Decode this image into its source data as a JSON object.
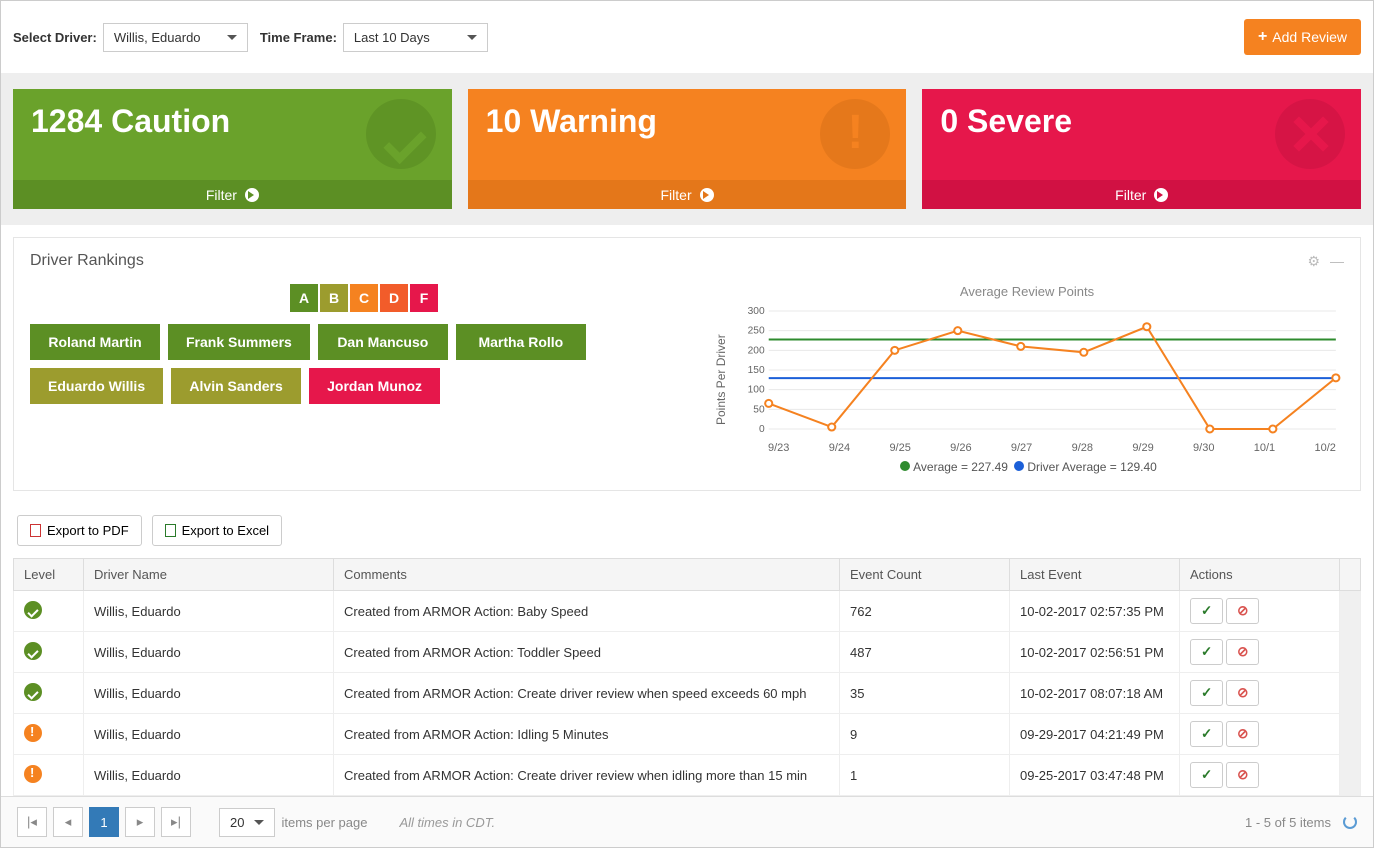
{
  "topbar": {
    "select_driver_label": "Select Driver:",
    "driver_value": "Willis, Eduardo",
    "time_frame_label": "Time Frame:",
    "time_frame_value": "Last 10 Days",
    "add_review_label": "Add Review"
  },
  "cards": {
    "caution": {
      "count": "1284",
      "label": "Caution",
      "filter": "Filter"
    },
    "warning": {
      "count": "10",
      "label": "Warning",
      "filter": "Filter"
    },
    "severe": {
      "count": "0",
      "label": "Severe",
      "filter": "Filter"
    }
  },
  "rankings": {
    "title": "Driver Rankings",
    "grades": [
      "A",
      "B",
      "C",
      "D",
      "F"
    ],
    "drivers": [
      {
        "name": "Roland Martin",
        "grade": "A"
      },
      {
        "name": "Frank Summers",
        "grade": "A"
      },
      {
        "name": "Dan Mancuso",
        "grade": "A"
      },
      {
        "name": "Martha Rollo",
        "grade": "A"
      },
      {
        "name": "Eduardo Willis",
        "grade": "B"
      },
      {
        "name": "Alvin Sanders",
        "grade": "B"
      },
      {
        "name": "Jordan Munoz",
        "grade": "F"
      }
    ]
  },
  "chart_data": {
    "type": "line",
    "title": "Average Review Points",
    "ylabel": "Points Per Driver",
    "ylim": [
      0,
      300
    ],
    "yticks": [
      0,
      50,
      100,
      150,
      200,
      250,
      300
    ],
    "categories": [
      "9/23",
      "9/24",
      "9/25",
      "9/26",
      "9/27",
      "9/28",
      "9/29",
      "9/30",
      "10/1",
      "10/2"
    ],
    "series": [
      {
        "name": "Points",
        "values": [
          65,
          5,
          200,
          250,
          210,
          195,
          260,
          0,
          0,
          130
        ],
        "color": "#f58220"
      }
    ],
    "reference_lines": [
      {
        "label": "Average = 227.49",
        "value": 227.49,
        "color": "#2e8b2e"
      },
      {
        "label": "Driver Average = 129.40",
        "value": 129.4,
        "color": "#1b5fd8"
      }
    ]
  },
  "export": {
    "pdf": "Export to PDF",
    "excel": "Export to Excel"
  },
  "table": {
    "headers": {
      "level": "Level",
      "driver": "Driver Name",
      "comments": "Comments",
      "count": "Event Count",
      "last": "Last Event",
      "actions": "Actions"
    },
    "rows": [
      {
        "level": "green",
        "driver": "Willis, Eduardo",
        "comments": "Created from ARMOR Action: Baby Speed",
        "count": "762",
        "last": "10-02-2017 02:57:35 PM"
      },
      {
        "level": "green",
        "driver": "Willis, Eduardo",
        "comments": "Created from ARMOR Action: Toddler Speed",
        "count": "487",
        "last": "10-02-2017 02:56:51 PM"
      },
      {
        "level": "green",
        "driver": "Willis, Eduardo",
        "comments": "Created from ARMOR Action: Create driver review when speed exceeds 60 mph",
        "count": "35",
        "last": "10-02-2017 08:07:18 AM"
      },
      {
        "level": "orange",
        "driver": "Willis, Eduardo",
        "comments": "Created from ARMOR Action: Idling 5 Minutes",
        "count": "9",
        "last": "09-29-2017 04:21:49 PM"
      },
      {
        "level": "orange",
        "driver": "Willis, Eduardo",
        "comments": "Created from ARMOR Action: Create driver review when idling more than 15 min",
        "count": "1",
        "last": "09-25-2017 03:47:48 PM"
      }
    ]
  },
  "pager": {
    "page": "1",
    "page_size": "20",
    "per_page_label": "items per page",
    "tz_note": "All times in CDT.",
    "summary": "1 - 5 of 5 items"
  }
}
